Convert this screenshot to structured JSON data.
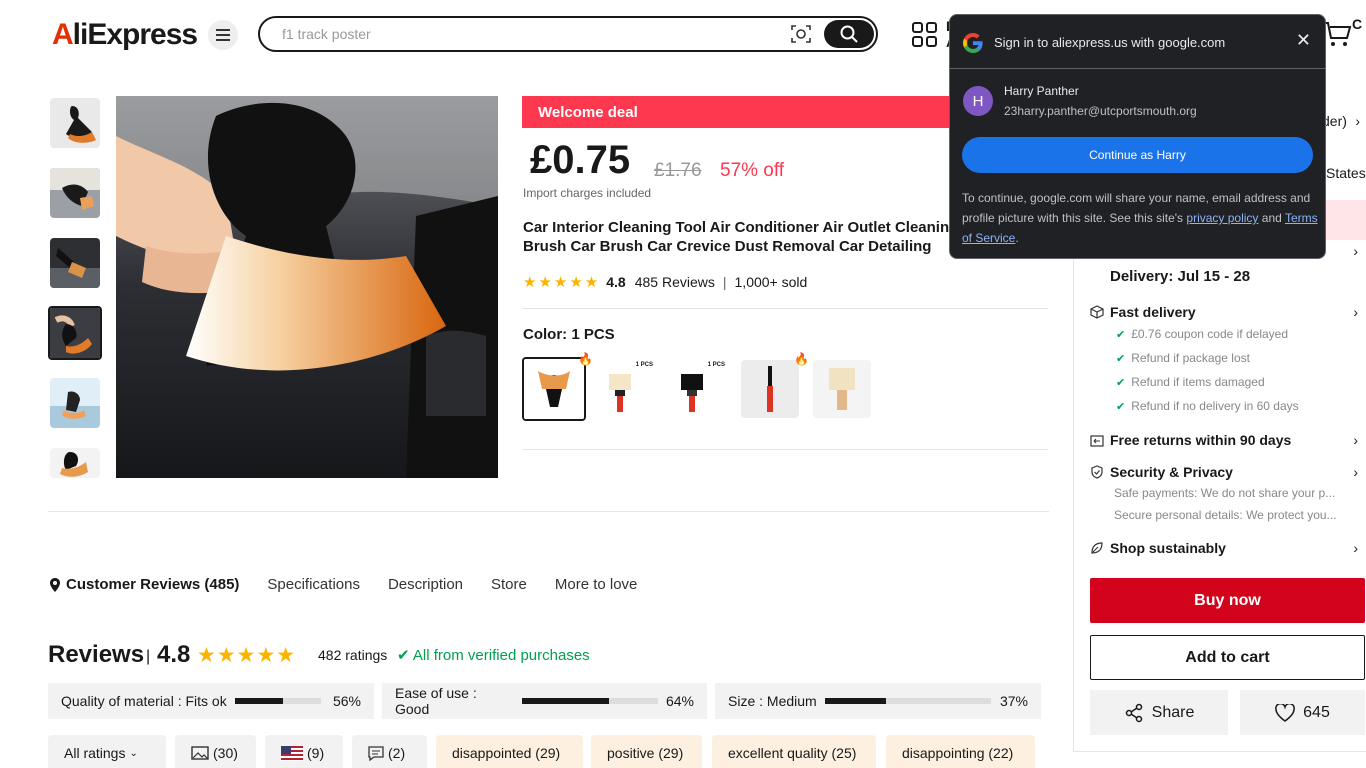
{
  "header": {
    "logo_a": "A",
    "logo_rest": "liExpress",
    "search_placeholder": "f1 track poster",
    "app_line1": "D",
    "app_line2": "A",
    "cart_count": "C"
  },
  "product": {
    "welcome": "Welcome deal",
    "price": "£0.75",
    "old_price": "£1.76",
    "discount": "57% off",
    "import_note": "Import charges included",
    "title": "Car Interior Cleaning Tool Air Conditioner Air Outlet Cleaning Brush Car Brush Car Crevice Dust Removal Car Detailing",
    "rating": "4.8",
    "reviews": "485 Reviews",
    "sold": "1,000+ sold",
    "color_label": "Color: 1 PCS",
    "swatch_labels": [
      "1 PCS",
      "1 PCS"
    ]
  },
  "tabs": [
    {
      "label": "Customer Reviews (485)"
    },
    {
      "label": "Specifications"
    },
    {
      "label": "Description"
    },
    {
      "label": "Store"
    },
    {
      "label": "More to love"
    }
  ],
  "reviews": {
    "title": "Reviews",
    "sep": "|",
    "score": "4.8",
    "ratings": "482 ratings",
    "verified": "All from verified purchases",
    "metrics": [
      {
        "label": "Quality of material : Fits ok",
        "value": 0.56,
        "pct": "56%"
      },
      {
        "label": "Ease of use : Good",
        "value": 0.64,
        "pct": "64%"
      },
      {
        "label": "Size : Medium",
        "value": 0.37,
        "pct": "37%"
      }
    ],
    "filters": {
      "all": "All ratings",
      "photo": "(30)",
      "country": "(9)",
      "comments": "(2)",
      "tags": [
        "disappointed (29)",
        "positive (29)",
        "excellent quality (25)",
        "disappointing (22)"
      ]
    }
  },
  "panel": {
    "row1_tail": "der)",
    "row2_tail": "States",
    "delivery": "Delivery: Jul 15 - 28",
    "fast_delivery": "Fast delivery",
    "fast_items": [
      "£0.76 coupon code if delayed",
      "Refund if package lost",
      "Refund if items damaged",
      "Refund if no delivery in 60 days"
    ],
    "free_returns": "Free returns within 90 days",
    "security": "Security & Privacy",
    "security_items": [
      "Safe payments: We do not share your p...",
      "Secure personal details: We protect you..."
    ],
    "sustain": "Shop sustainably",
    "buy_now": "Buy now",
    "add_cart": "Add to cart",
    "share": "Share",
    "wishes": "645"
  },
  "google_popup": {
    "heading": "Sign in to aliexpress.us with google.com",
    "avatar_letter": "H",
    "name": "Harry Panther",
    "email": "23harry.panther@utcportsmouth.org",
    "continue": "Continue as Harry",
    "fine_1": "To continue, google.com will share your name, email address and profile picture with this site. See this site's",
    "privacy": "privacy policy",
    "and": "and",
    "terms": "Terms of Service",
    "period": "."
  }
}
